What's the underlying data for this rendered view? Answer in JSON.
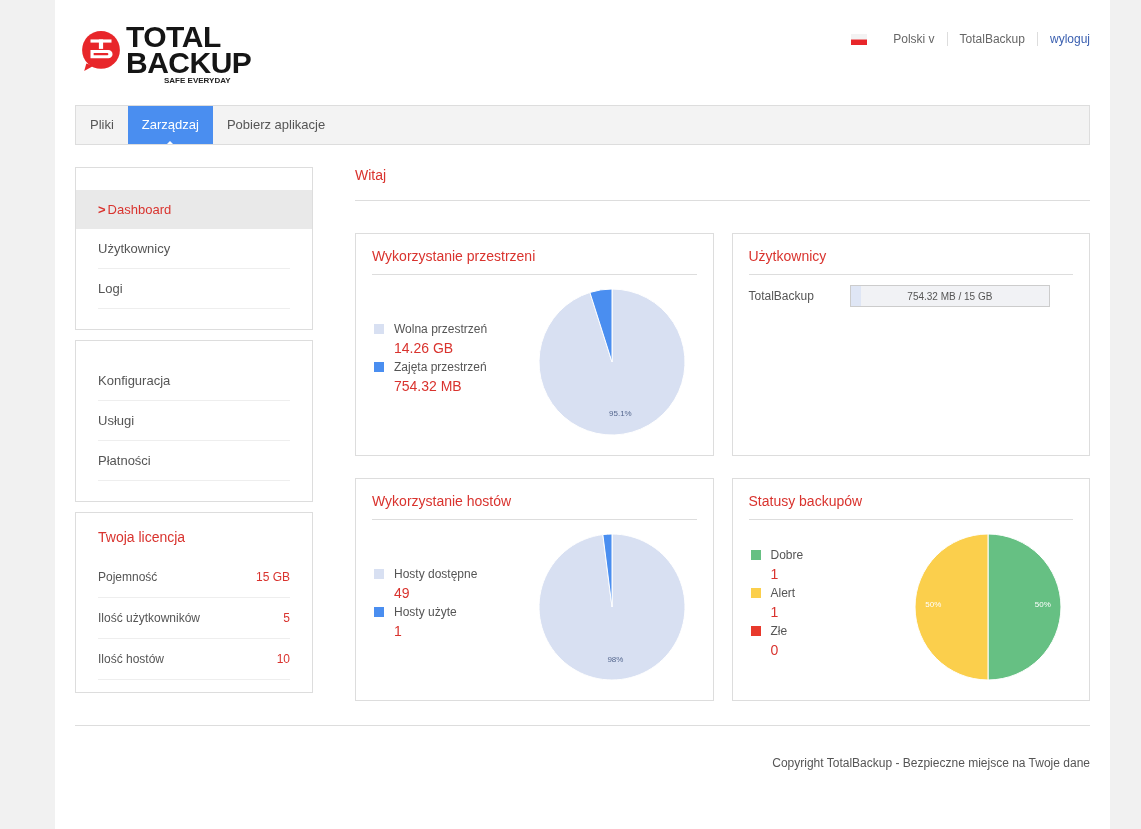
{
  "header": {
    "logo": {
      "title_line1": "TOTAL",
      "title_line2": "BACKUP",
      "tagline": "SAFE EVERYDAY"
    },
    "language": "Polski v",
    "user": "TotalBackup",
    "logout": "wyloguj"
  },
  "tabs": [
    {
      "label": "Pliki",
      "selected": false
    },
    {
      "label": "Zarządzaj",
      "selected": true
    },
    {
      "label": "Pobierz aplikacje",
      "selected": false
    }
  ],
  "sidebar": {
    "menu_groups": [
      [
        {
          "label": "Dashboard",
          "selected": true
        },
        {
          "label": "Użytkownicy",
          "selected": false
        },
        {
          "label": "Logi",
          "selected": false
        }
      ],
      [
        {
          "label": "Konfiguracja",
          "selected": false
        },
        {
          "label": "Usługi",
          "selected": false
        },
        {
          "label": "Płatności",
          "selected": false
        }
      ]
    ],
    "license": {
      "title": "Twoja licencja",
      "rows": [
        {
          "label": "Pojemność",
          "value": "15 GB"
        },
        {
          "label": "Ilość użytkowników",
          "value": "5"
        },
        {
          "label": "Ilość hostów",
          "value": "10"
        }
      ]
    },
    "selected_marker": ">"
  },
  "page_title": "Witaj",
  "panels": [
    {
      "kind": "pie",
      "legend": [
        {
          "value": "14.26 GB",
          "color": "#d8e0f2"
        },
        {
          "value": "754.32 MB",
          "color": "#4a8ef0"
        }
      ],
      "chart_data": {
        "type": "pie",
        "title": "Wykorzystanie przestrzeni",
        "categories": [
          "Wolna przestrzeń",
          "Zajęta przestrzeń"
        ],
        "values": [
          95.1,
          4.9
        ],
        "value_labels": [
          "95.1%",
          null
        ]
      }
    },
    {
      "kind": "users",
      "title": "Użytkownicy",
      "users": [
        {
          "name": "TotalBackup",
          "usage": "754.32 MB / 15 GB",
          "level": 0.05
        }
      ]
    },
    {
      "kind": "pie",
      "legend": [
        {
          "value": "49",
          "color": "#d8e0f2"
        },
        {
          "value": "1",
          "color": "#4a8ef0"
        }
      ],
      "chart_data": {
        "type": "pie",
        "title": "Wykorzystanie hostów",
        "categories": [
          "Hosty dostępne",
          "Hosty użyte"
        ],
        "values": [
          98,
          2
        ],
        "value_labels": [
          "98%",
          null
        ]
      }
    },
    {
      "kind": "pie",
      "legend": [
        {
          "value": "1",
          "color": "#66c083"
        },
        {
          "value": "1",
          "color": "#fbcf4c"
        },
        {
          "value": "0",
          "color": "#e8392c"
        }
      ],
      "chart_data": {
        "type": "pie",
        "title": "Statusy backupów",
        "categories": [
          "Dobre",
          "Alert",
          "Złe"
        ],
        "values": [
          50,
          50,
          0
        ],
        "value_labels": [
          "50%",
          "50%",
          null
        ]
      }
    }
  ],
  "footer": "Copyright TotalBackup - Bezpieczne miejsce na Twoje dane"
}
